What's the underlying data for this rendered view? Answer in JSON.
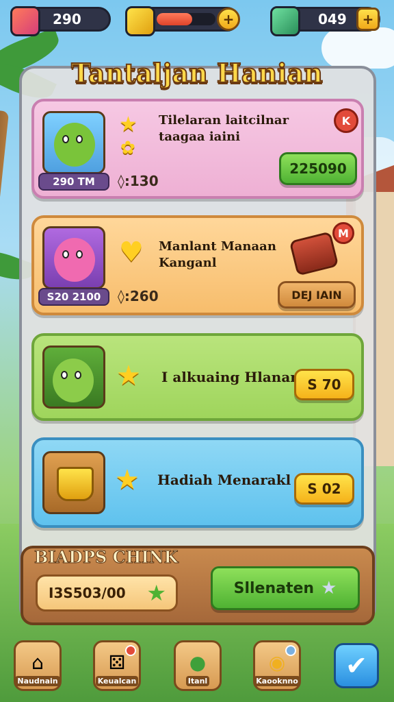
{
  "hud": {
    "left_value": "290",
    "right_value": "049",
    "energy_fill": 0.6,
    "plus_symbol": "+"
  },
  "panel": {
    "title": "Tantaljan Hanian"
  },
  "cards": [
    {
      "thumb_badge": "290 TM",
      "meta": "◊:130",
      "text": "Tilelaran laitcilnar taagaa iaini",
      "button": "225090",
      "close": "K"
    },
    {
      "thumb_badge": "S20 2100",
      "meta": "◊:260",
      "text": "Manlant Manaan Kanganl",
      "button": "DEJ IAIN",
      "close": "M"
    },
    {
      "text": "I alkuaing Hlanani",
      "button": "S 70"
    },
    {
      "text": "Hadiah Menarakl",
      "button": "S 02"
    }
  ],
  "bottom": {
    "title": "BIADPS CHINK",
    "code_value": "I3S503/00",
    "button": "Sllenaten"
  },
  "nav": [
    {
      "label": "Naudnain",
      "icon": "home-icon"
    },
    {
      "label": "Keualcan",
      "icon": "dice-icon"
    },
    {
      "label": "Itanl",
      "icon": "chat-icon"
    },
    {
      "label": "Kaooknno",
      "icon": "coin-icon"
    }
  ],
  "colors": {
    "accent_gold": "#ffd84a",
    "btn_green": "#4fb233",
    "btn_yellow": "#f5b21a",
    "close_red": "#e24b3a"
  }
}
